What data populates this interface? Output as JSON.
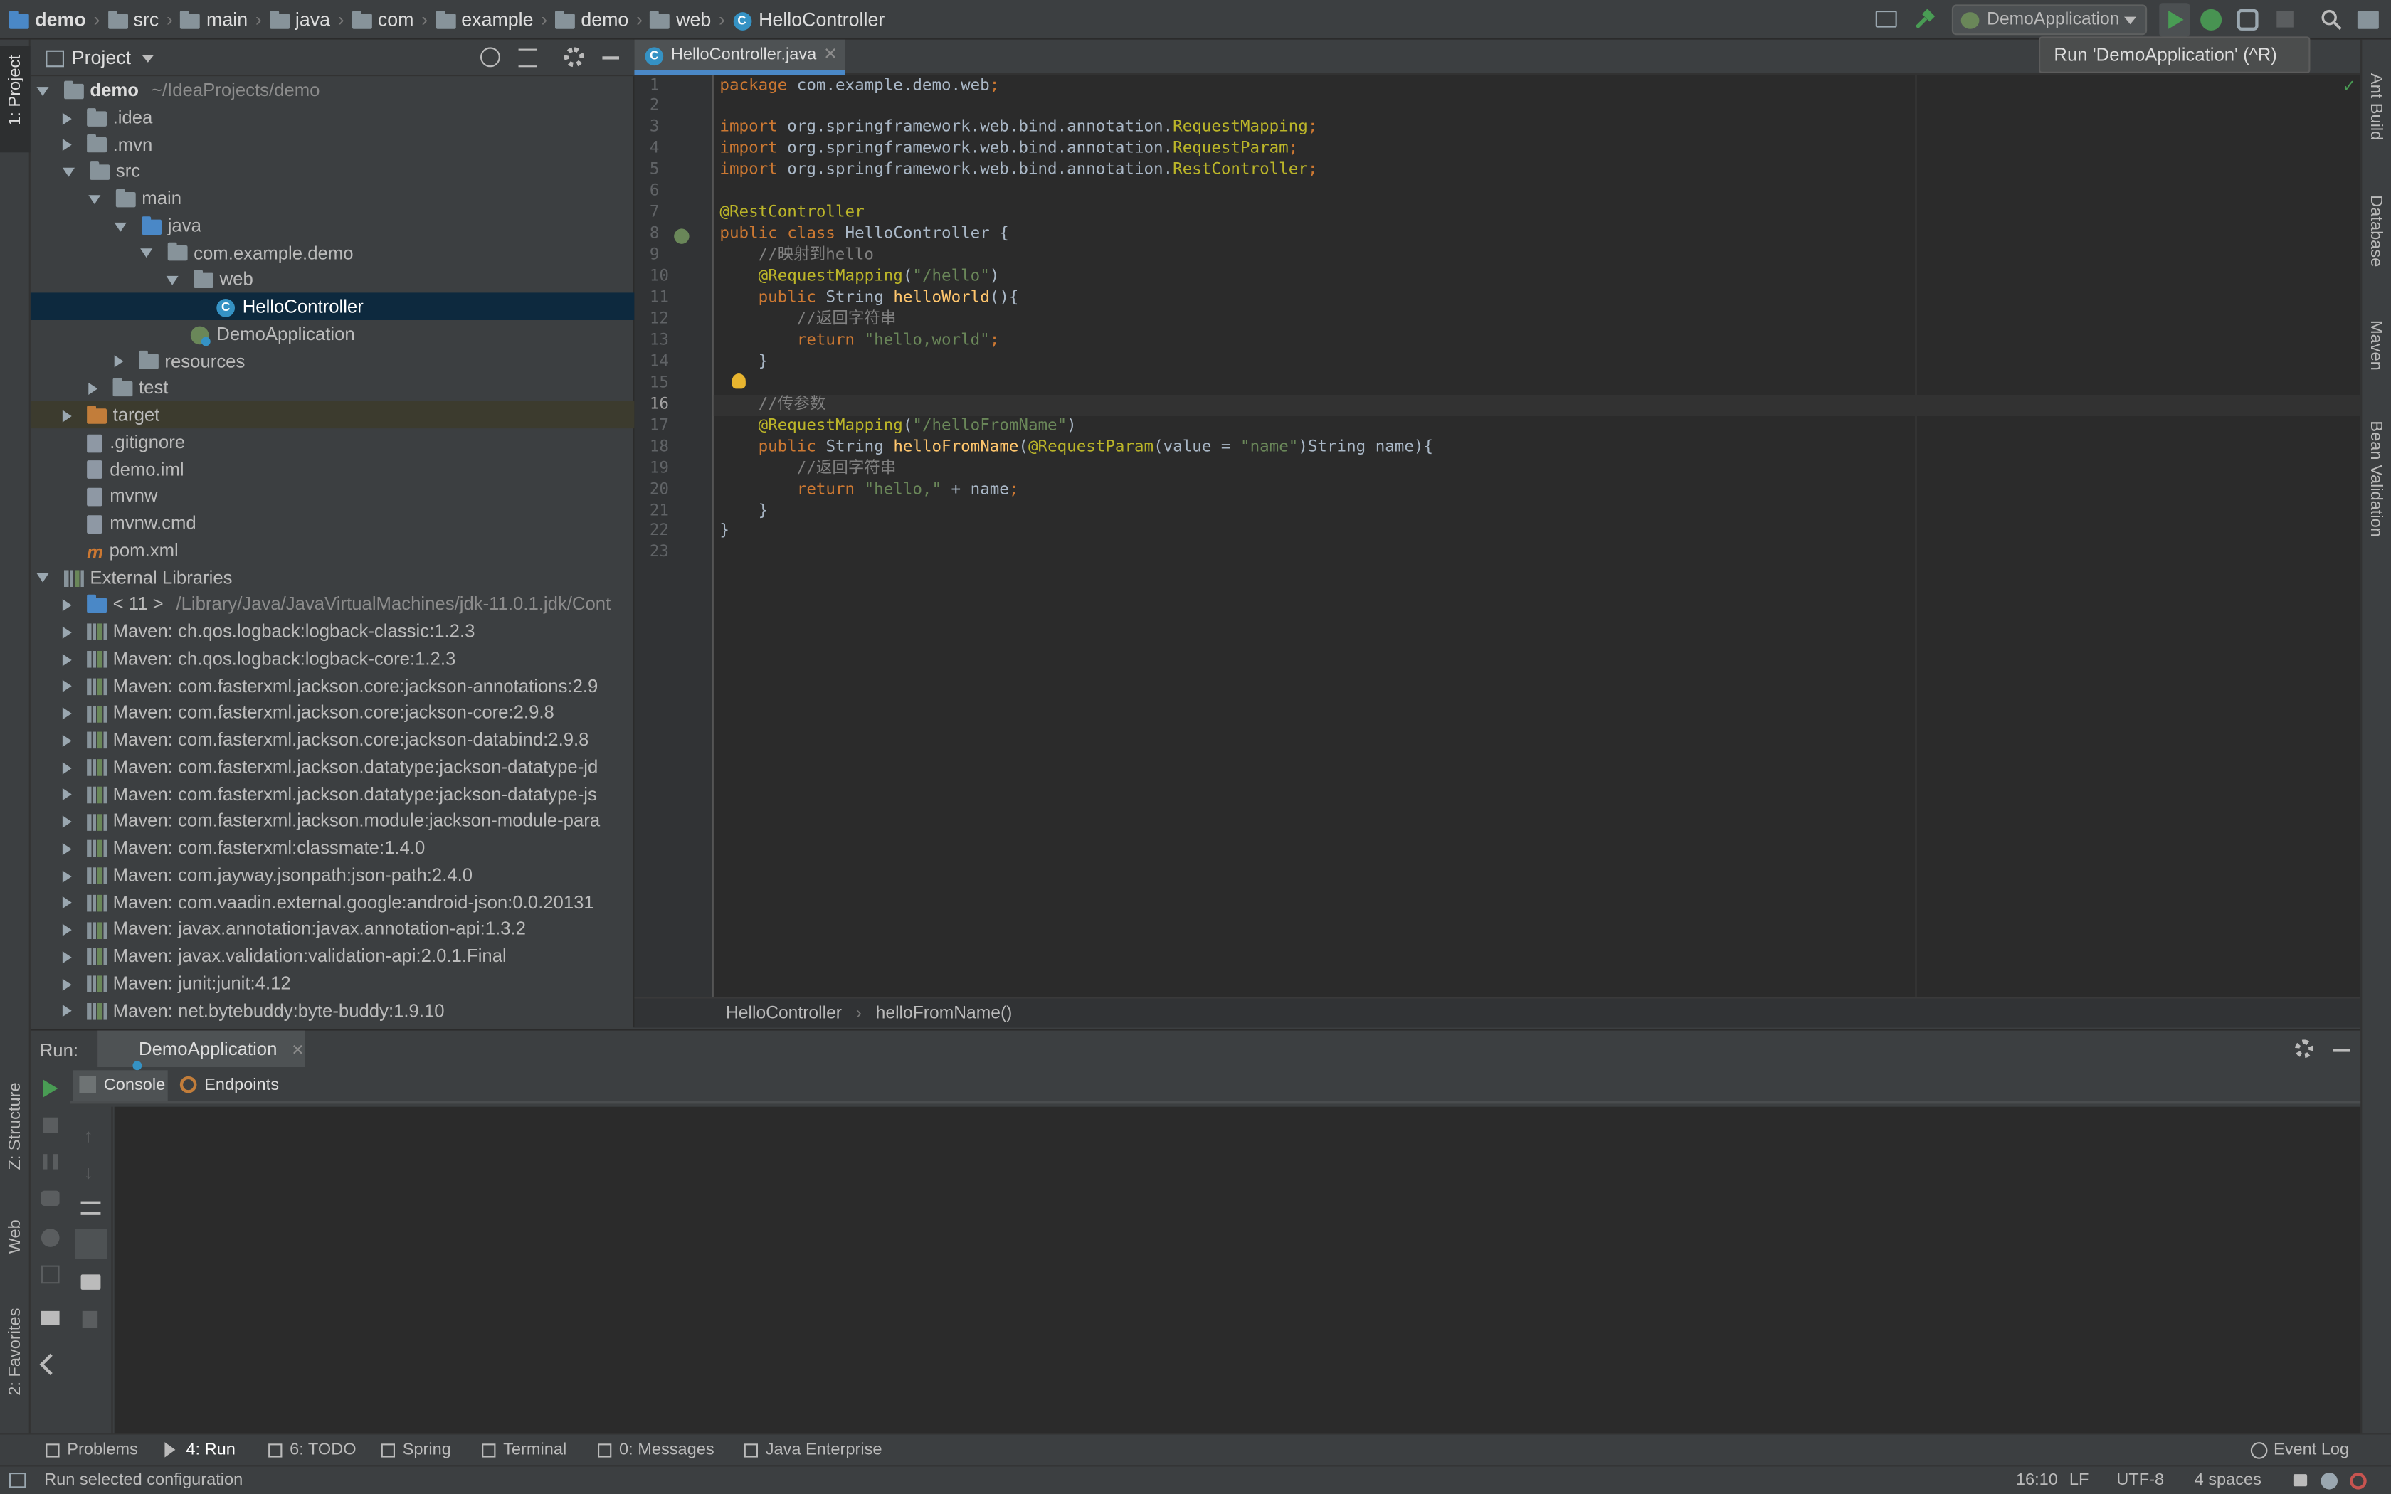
{
  "breadcrumb": {
    "items": [
      "demo",
      "src",
      "main",
      "java",
      "com",
      "example",
      "demo",
      "web",
      "HelloController"
    ]
  },
  "toolbar": {
    "run_config": "DemoApplication",
    "tooltip": "Run 'DemoApplication' (^R)"
  },
  "project_panel": {
    "title": "Project"
  },
  "tree": [
    {
      "label": "demo",
      "suffix": "~/IdeaProjects/demo",
      "level": 0,
      "arrow": "down",
      "icon": "folder"
    },
    {
      "label": ".idea",
      "level": 1,
      "arrow": "right",
      "icon": "folder"
    },
    {
      "label": ".mvn",
      "level": 1,
      "arrow": "right",
      "icon": "folder"
    },
    {
      "label": "src",
      "level": 1,
      "arrow": "down",
      "icon": "folder"
    },
    {
      "label": "main",
      "level": 2,
      "arrow": "down",
      "icon": "folder"
    },
    {
      "label": "java",
      "level": 3,
      "arrow": "down",
      "icon": "folder-blue"
    },
    {
      "label": "com.example.demo",
      "level": 4,
      "arrow": "down",
      "icon": "package"
    },
    {
      "label": "web",
      "level": 5,
      "arrow": "down",
      "icon": "package"
    },
    {
      "label": "HelloController",
      "level": 6,
      "arrow": "none",
      "icon": "class",
      "selected": true
    },
    {
      "label": "DemoApplication",
      "level": 5,
      "arrow": "none",
      "icon": "spring-class"
    },
    {
      "label": "resources",
      "level": 3,
      "arrow": "right",
      "icon": "folder"
    },
    {
      "label": "test",
      "level": 2,
      "arrow": "right",
      "icon": "folder"
    },
    {
      "label": "target",
      "level": 1,
      "arrow": "right",
      "icon": "folder-orange",
      "target": true
    },
    {
      "label": ".gitignore",
      "level": 1,
      "arrow": "none",
      "icon": "file"
    },
    {
      "label": "demo.iml",
      "level": 1,
      "arrow": "none",
      "icon": "file"
    },
    {
      "label": "mvnw",
      "level": 1,
      "arrow": "none",
      "icon": "file"
    },
    {
      "label": "mvnw.cmd",
      "level": 1,
      "arrow": "none",
      "icon": "file"
    },
    {
      "label": "pom.xml",
      "level": 1,
      "arrow": "none",
      "icon": "maven"
    },
    {
      "label": "External Libraries",
      "level": 0,
      "arrow": "down",
      "icon": "lib"
    },
    {
      "label": "< 11 >",
      "suffix": "/Library/Java/JavaVirtualMachines/jdk-11.0.1.jdk/Cont",
      "level": 1,
      "arrow": "right",
      "icon": "jdk"
    },
    {
      "label": "Maven: ch.qos.logback:logback-classic:1.2.3",
      "level": 1,
      "arrow": "right",
      "icon": "lib"
    },
    {
      "label": "Maven: ch.qos.logback:logback-core:1.2.3",
      "level": 1,
      "arrow": "right",
      "icon": "lib"
    },
    {
      "label": "Maven: com.fasterxml.jackson.core:jackson-annotations:2.9",
      "level": 1,
      "arrow": "right",
      "icon": "lib"
    },
    {
      "label": "Maven: com.fasterxml.jackson.core:jackson-core:2.9.8",
      "level": 1,
      "arrow": "right",
      "icon": "lib"
    },
    {
      "label": "Maven: com.fasterxml.jackson.core:jackson-databind:2.9.8",
      "level": 1,
      "arrow": "right",
      "icon": "lib"
    },
    {
      "label": "Maven: com.fasterxml.jackson.datatype:jackson-datatype-jd",
      "level": 1,
      "arrow": "right",
      "icon": "lib"
    },
    {
      "label": "Maven: com.fasterxml.jackson.datatype:jackson-datatype-js",
      "level": 1,
      "arrow": "right",
      "icon": "lib"
    },
    {
      "label": "Maven: com.fasterxml.jackson.module:jackson-module-para",
      "level": 1,
      "arrow": "right",
      "icon": "lib"
    },
    {
      "label": "Maven: com.fasterxml:classmate:1.4.0",
      "level": 1,
      "arrow": "right",
      "icon": "lib"
    },
    {
      "label": "Maven: com.jayway.jsonpath:json-path:2.4.0",
      "level": 1,
      "arrow": "right",
      "icon": "lib"
    },
    {
      "label": "Maven: com.vaadin.external.google:android-json:0.0.20131",
      "level": 1,
      "arrow": "right",
      "icon": "lib"
    },
    {
      "label": "Maven: javax.annotation:javax.annotation-api:1.3.2",
      "level": 1,
      "arrow": "right",
      "icon": "lib"
    },
    {
      "label": "Maven: javax.validation:validation-api:2.0.1.Final",
      "level": 1,
      "arrow": "right",
      "icon": "lib"
    },
    {
      "label": "Maven: junit:junit:4.12",
      "level": 1,
      "arrow": "right",
      "icon": "lib"
    },
    {
      "label": "Maven: net.bytebuddy:byte-buddy:1.9.10",
      "level": 1,
      "arrow": "right",
      "icon": "lib"
    }
  ],
  "editor": {
    "tab_label": "HelloController.java",
    "current_line": 16,
    "lines": [
      [
        [
          "kw",
          "package "
        ],
        [
          "",
          "com.example.demo.web"
        ],
        [
          "kw",
          ";"
        ]
      ],
      [],
      [
        [
          "kw",
          "import "
        ],
        [
          "",
          "org.springframework.web.bind.annotation."
        ],
        [
          "an",
          "RequestMapping"
        ],
        [
          "kw",
          ";"
        ]
      ],
      [
        [
          "kw",
          "import "
        ],
        [
          "",
          "org.springframework.web.bind.annotation."
        ],
        [
          "an",
          "RequestParam"
        ],
        [
          "kw",
          ";"
        ]
      ],
      [
        [
          "kw",
          "import "
        ],
        [
          "",
          "org.springframework.web.bind.annotation."
        ],
        [
          "an",
          "RestController"
        ],
        [
          "kw",
          ";"
        ]
      ],
      [],
      [
        [
          "an",
          "@RestController"
        ]
      ],
      [
        [
          "kw",
          "public class "
        ],
        [
          "",
          "HelloController {"
        ]
      ],
      [
        [
          "cm",
          "    //映射到hello"
        ]
      ],
      [
        [
          "",
          "    "
        ],
        [
          "an",
          "@RequestMapping"
        ],
        [
          "",
          "("
        ],
        [
          "str",
          "\"/hello\""
        ],
        [
          "",
          ")"
        ]
      ],
      [
        [
          "kw",
          "    public "
        ],
        [
          "",
          "String "
        ],
        [
          "fn",
          "helloWorld"
        ],
        [
          "",
          "(){"
        ]
      ],
      [
        [
          "cm",
          "        //返回字符串"
        ]
      ],
      [
        [
          "kw",
          "        return "
        ],
        [
          "str",
          "\"hello,world\""
        ],
        [
          "kw",
          ";"
        ]
      ],
      [
        [
          "",
          "    }"
        ]
      ],
      [],
      [
        [
          "cm",
          "    //传参数"
        ]
      ],
      [
        [
          "",
          "    "
        ],
        [
          "an",
          "@RequestMapping"
        ],
        [
          "",
          "("
        ],
        [
          "str",
          "\"/helloFromName\""
        ],
        [
          "",
          ")"
        ]
      ],
      [
        [
          "kw",
          "    public "
        ],
        [
          "",
          "String "
        ],
        [
          "fn",
          "helloFromName"
        ],
        [
          "",
          "("
        ],
        [
          "an",
          "@RequestParam"
        ],
        [
          "",
          "(value = "
        ],
        [
          "str",
          "\"name\""
        ],
        [
          "",
          ")String name){"
        ]
      ],
      [
        [
          "cm",
          "        //返回字符串"
        ]
      ],
      [
        [
          "kw",
          "        return "
        ],
        [
          "str",
          "\"hello,\""
        ],
        [
          "",
          " + name"
        ],
        [
          "kw",
          ";"
        ]
      ],
      [
        [
          "",
          "    }"
        ]
      ],
      [
        [
          "",
          "}"
        ]
      ],
      []
    ],
    "line_numbers": [
      "1",
      "2",
      "3",
      "4",
      "5",
      "6",
      "7",
      "8",
      "9",
      "10",
      "11",
      "12",
      "13",
      "14",
      "15",
      "16",
      "17",
      "18",
      "19",
      "20",
      "21",
      "22",
      "23"
    ],
    "breadcrumb": [
      "HelloController",
      "helloFromName()"
    ]
  },
  "run_panel": {
    "label": "Run:",
    "tab": "DemoApplication",
    "console_tab": "Console",
    "endpoints_tab": "Endpoints"
  },
  "bottom_tabs": [
    {
      "label": "Problems",
      "icon": "warning-icon"
    },
    {
      "label": "4: Run",
      "icon": "run-icon",
      "active": true
    },
    {
      "label": "6: TODO",
      "icon": "todo-icon"
    },
    {
      "label": "Spring",
      "icon": "spring-icon"
    },
    {
      "label": "Terminal",
      "icon": "terminal-icon"
    },
    {
      "label": "0: Messages",
      "icon": "messages-icon"
    },
    {
      "label": "Java Enterprise",
      "icon": "java-ee-icon"
    }
  ],
  "event_log": "Event Log",
  "status": {
    "message": "Run selected configuration",
    "position": "16:10",
    "line_sep": "LF",
    "encoding": "UTF-8",
    "indent": "4 spaces"
  },
  "left_strip": {
    "project": "1: Project",
    "structure": "Z: Structure",
    "web": "Web",
    "favorites": "2: Favorites"
  },
  "right_strip": {
    "ant": "Ant Build",
    "database": "Database",
    "maven": "Maven",
    "bean": "Bean Validation"
  },
  "colors": {
    "accent": "#3592c4",
    "selection": "#0d293e",
    "run_green": "#499c54"
  }
}
